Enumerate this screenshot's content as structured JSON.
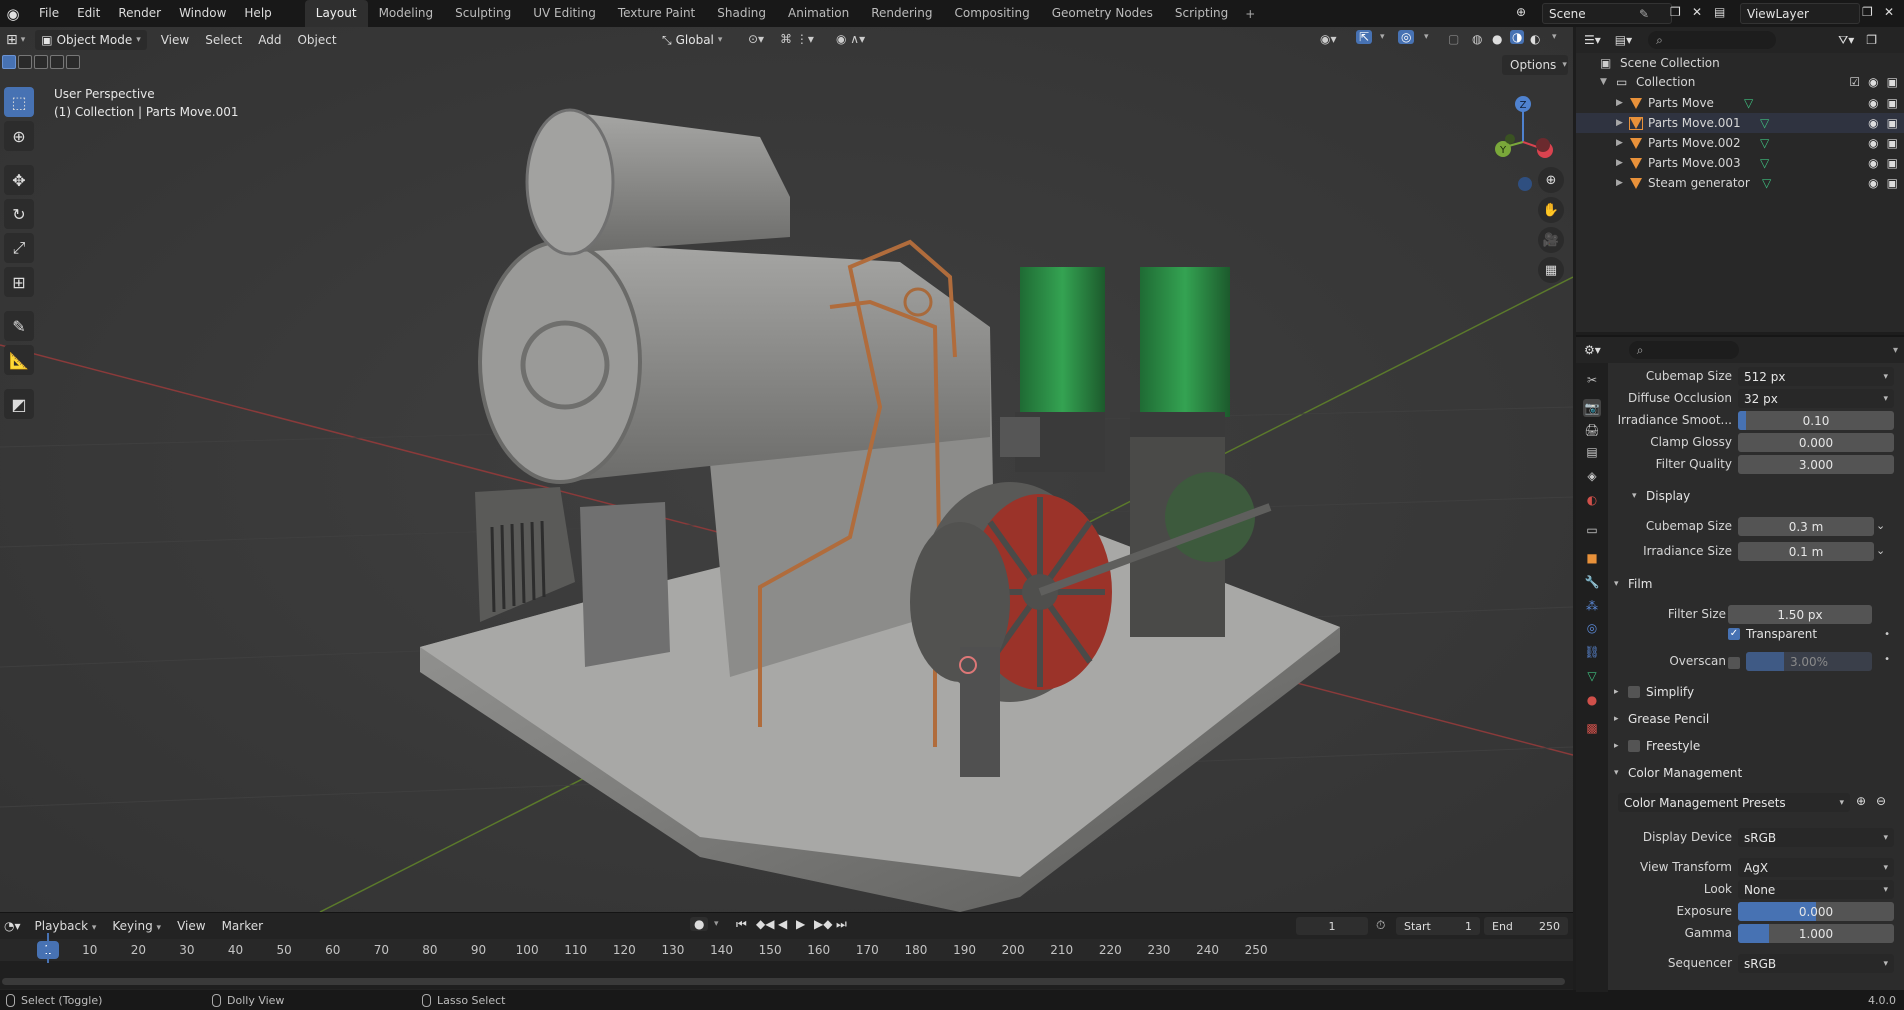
{
  "topbar": {
    "menus": [
      "File",
      "Edit",
      "Render",
      "Window",
      "Help"
    ],
    "workspaces": [
      "Layout",
      "Modeling",
      "Sculpting",
      "UV Editing",
      "Texture Paint",
      "Shading",
      "Animation",
      "Rendering",
      "Compositing",
      "Geometry Nodes",
      "Scripting"
    ],
    "active_workspace": "Layout",
    "scene_name": "Scene",
    "view_layer": "ViewLayer"
  },
  "viewport": {
    "mode": "Object Mode",
    "menus": [
      "View",
      "Select",
      "Add",
      "Object"
    ],
    "transform_orientation": "Global",
    "options_label": "Options",
    "info_line1": "User Perspective",
    "info_line2": "(1) Collection | Parts Move.001",
    "gizmo": {
      "z": "Z",
      "y": "Y"
    }
  },
  "timeline": {
    "menus": [
      "Playback",
      "Keying",
      "View",
      "Marker"
    ],
    "current_frame": "1",
    "start_label": "Start",
    "start": "1",
    "end_label": "End",
    "end": "250",
    "ticks": [
      "10",
      "20",
      "30",
      "40",
      "50",
      "60",
      "70",
      "80",
      "90",
      "100",
      "110",
      "120",
      "130",
      "140",
      "150",
      "160",
      "170",
      "180",
      "190",
      "200",
      "210",
      "220",
      "230",
      "240",
      "250"
    ],
    "playhead_label": "1"
  },
  "status": {
    "left": "Select (Toggle)",
    "middle": "Dolly View",
    "right": "Lasso Select",
    "version": "4.0.0"
  },
  "outliner": {
    "root": "Scene Collection",
    "collection": "Collection",
    "items": [
      "Parts Move",
      "Parts Move.001",
      "Parts Move.002",
      "Parts Move.003",
      "Steam generator"
    ]
  },
  "properties": {
    "cubemap_size_label": "Cubemap Size",
    "cubemap_size": "512 px",
    "diffuse_occlusion_label": "Diffuse Occlusion",
    "diffuse_occlusion": "32 px",
    "irradiance_smooth_label": "Irradiance Smoot...",
    "irradiance_smooth": "0.10",
    "irradiance_smooth_fill": 0.05,
    "clamp_glossy_label": "Clamp Glossy",
    "clamp_glossy": "0.000",
    "filter_quality_label": "Filter Quality",
    "filter_quality": "3.000",
    "display_header": "Display",
    "display_cubemap_label": "Cubemap Size",
    "display_cubemap": "0.3 m",
    "display_irradiance_label": "Irradiance Size",
    "display_irradiance": "0.1 m",
    "film_header": "Film",
    "filter_size_label": "Filter Size",
    "filter_size": "1.50 px",
    "transparent_label": "Transparent",
    "overscan_label": "Overscan",
    "overscan": "3.00%",
    "simplify_header": "Simplify",
    "grease_pencil_header": "Grease Pencil",
    "freestyle_header": "Freestyle",
    "color_mgmt_header": "Color Management",
    "presets_label": "Color Management Presets",
    "display_device_label": "Display Device",
    "display_device": "sRGB",
    "view_transform_label": "View Transform",
    "view_transform": "AgX",
    "look_label": "Look",
    "look": "None",
    "exposure_label": "Exposure",
    "exposure": "0.000",
    "exposure_fill": 0.5,
    "gamma_label": "Gamma",
    "gamma": "1.000",
    "gamma_fill": 0.2,
    "sequencer_label": "Sequencer",
    "sequencer": "sRGB"
  },
  "colors": {
    "accent": "#4772b3",
    "object_orange": "#e8913a",
    "mesh_green": "#3fbf7f"
  }
}
